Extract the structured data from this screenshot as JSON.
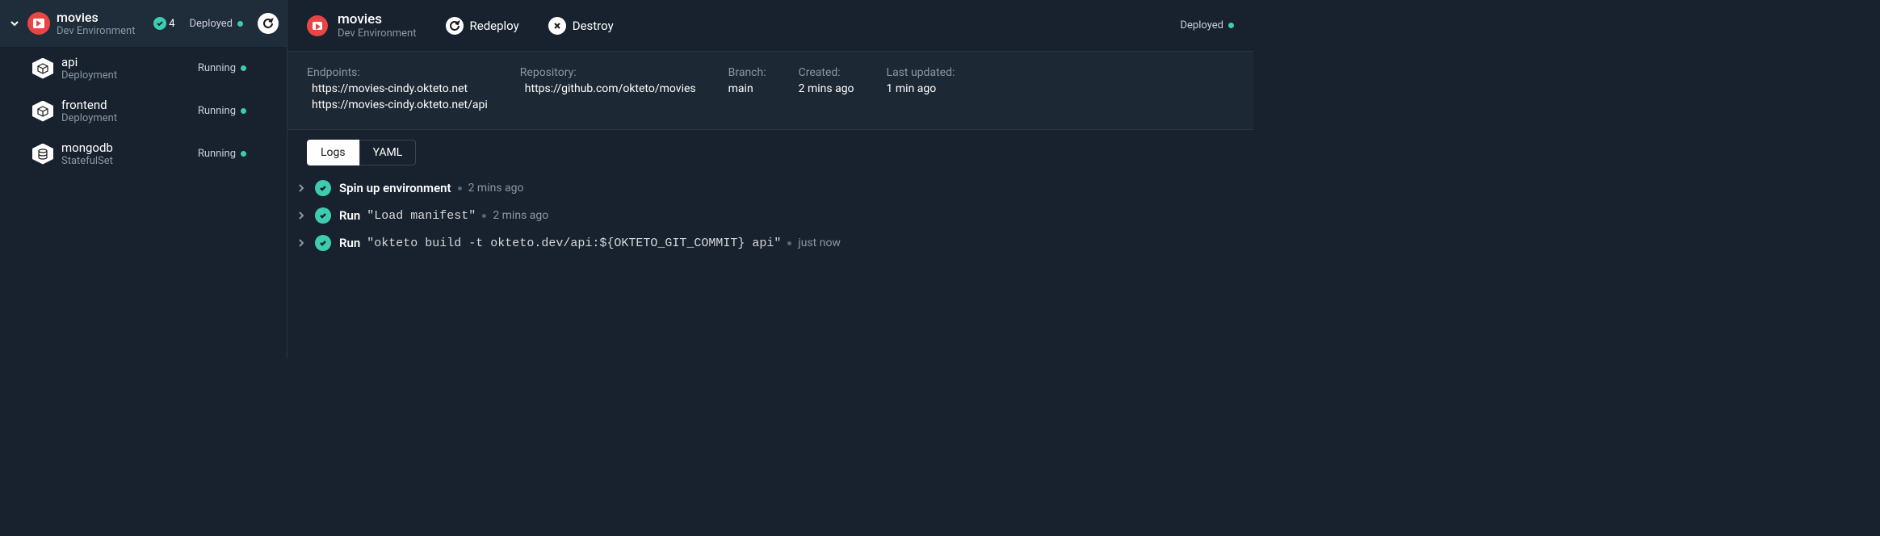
{
  "sidebar": {
    "env": {
      "title": "movies",
      "subtitle": "Dev Environment",
      "badge_count": "4",
      "status": "Deployed"
    },
    "components": [
      {
        "name": "api",
        "type": "Deployment",
        "status": "Running",
        "icon": "cube"
      },
      {
        "name": "frontend",
        "type": "Deployment",
        "status": "Running",
        "icon": "cube"
      },
      {
        "name": "mongodb",
        "type": "StatefulSet",
        "status": "Running",
        "icon": "database"
      }
    ]
  },
  "main": {
    "title": "movies",
    "subtitle": "Dev Environment",
    "actions": {
      "redeploy": "Redeploy",
      "destroy": "Destroy"
    },
    "status": "Deployed",
    "info": {
      "endpoints_label": "Endpoints:",
      "endpoints": [
        "https://movies-cindy.okteto.net",
        "https://movies-cindy.okteto.net/api"
      ],
      "repository_label": "Repository:",
      "repository": "https://github.com/okteto/movies",
      "branch_label": "Branch:",
      "branch": "main",
      "created_label": "Created:",
      "created": "2 mins ago",
      "updated_label": "Last updated:",
      "updated": "1 min ago"
    },
    "tabs": {
      "logs": "Logs",
      "yaml": "YAML"
    },
    "logs": [
      {
        "cmd": "Spin up environment",
        "args": "",
        "time": "2 mins ago"
      },
      {
        "cmd": "Run",
        "args": "\"Load manifest\"",
        "time": "2 mins ago"
      },
      {
        "cmd": "Run",
        "args": "\"okteto build -t okteto.dev/api:${OKTETO_GIT_COMMIT} api\"",
        "time": "just now"
      }
    ]
  }
}
